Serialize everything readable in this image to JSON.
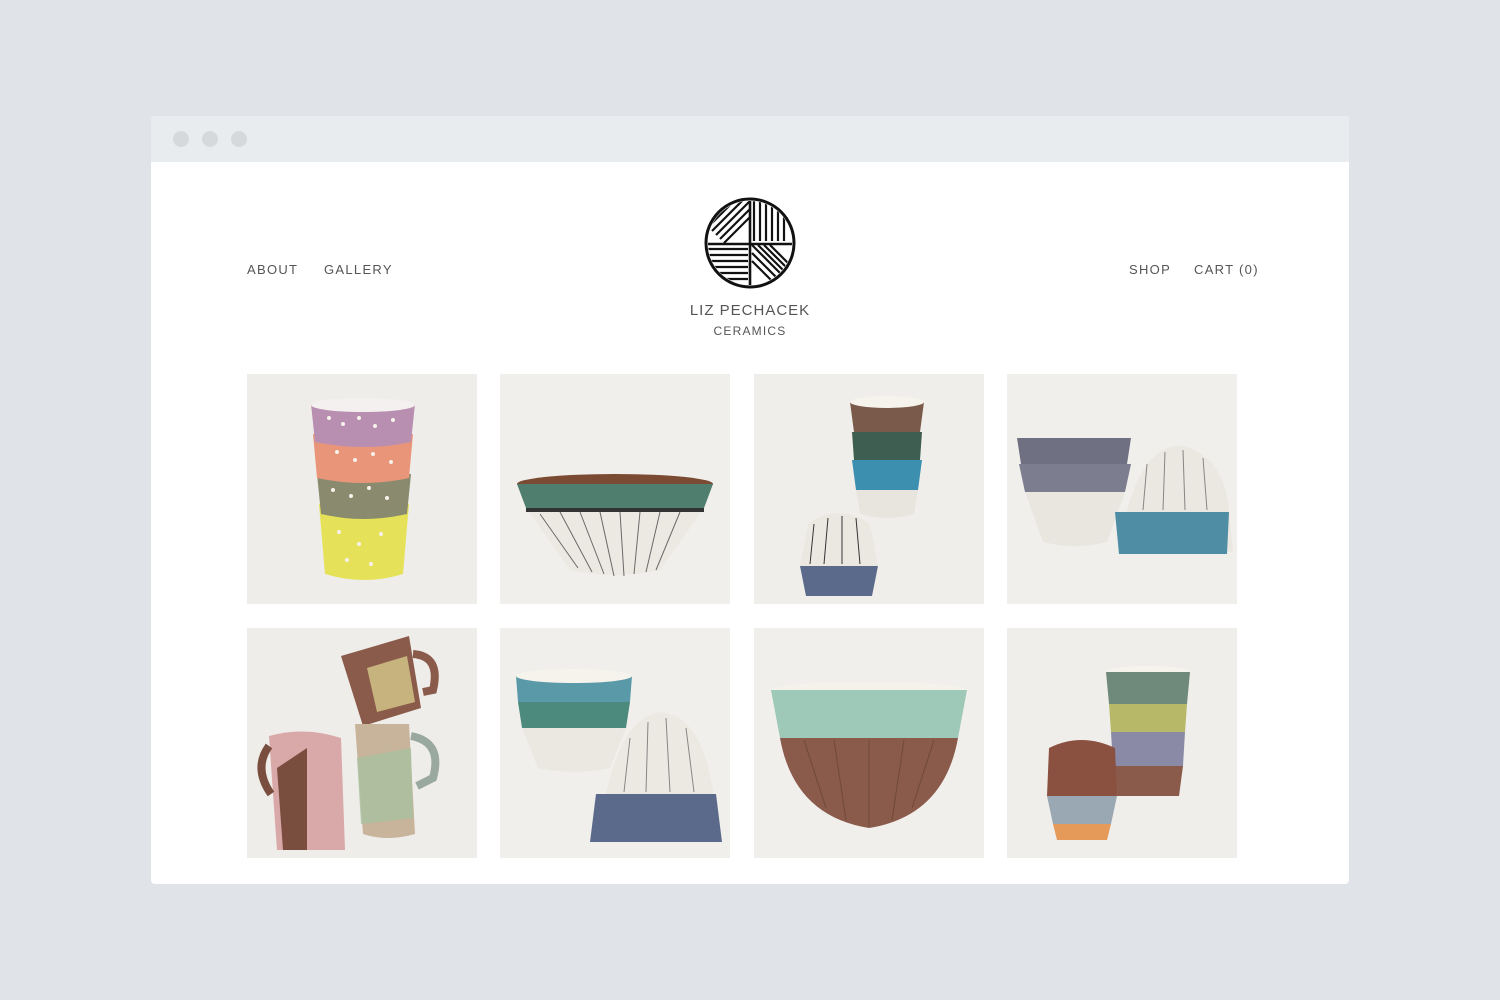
{
  "nav": {
    "left": [
      {
        "label": "ABOUT"
      },
      {
        "label": "GALLERY"
      }
    ],
    "right": [
      {
        "label": "SHOP"
      },
      {
        "label": "CART (0)"
      }
    ]
  },
  "brand": {
    "name_line1": "LIZ PECHACEK",
    "name_line2": "CERAMICS"
  },
  "gallery": {
    "items": [
      {
        "subject": "stack of four dotted cups (lilac, coral, olive, yellow)"
      },
      {
        "subject": "wide bowl with green band and black pinstripe base"
      },
      {
        "subject": "stacked small cups with blue bands"
      },
      {
        "subject": "nested grey bowls and inverted blue-band bowl"
      },
      {
        "subject": "colorful patterned mugs"
      },
      {
        "subject": "stacked teal bowls and inverted striped bowl"
      },
      {
        "subject": "deep bowl with mint rim and brown base"
      },
      {
        "subject": "stacked striped cups in green, yellow, lilac and orange"
      }
    ]
  }
}
